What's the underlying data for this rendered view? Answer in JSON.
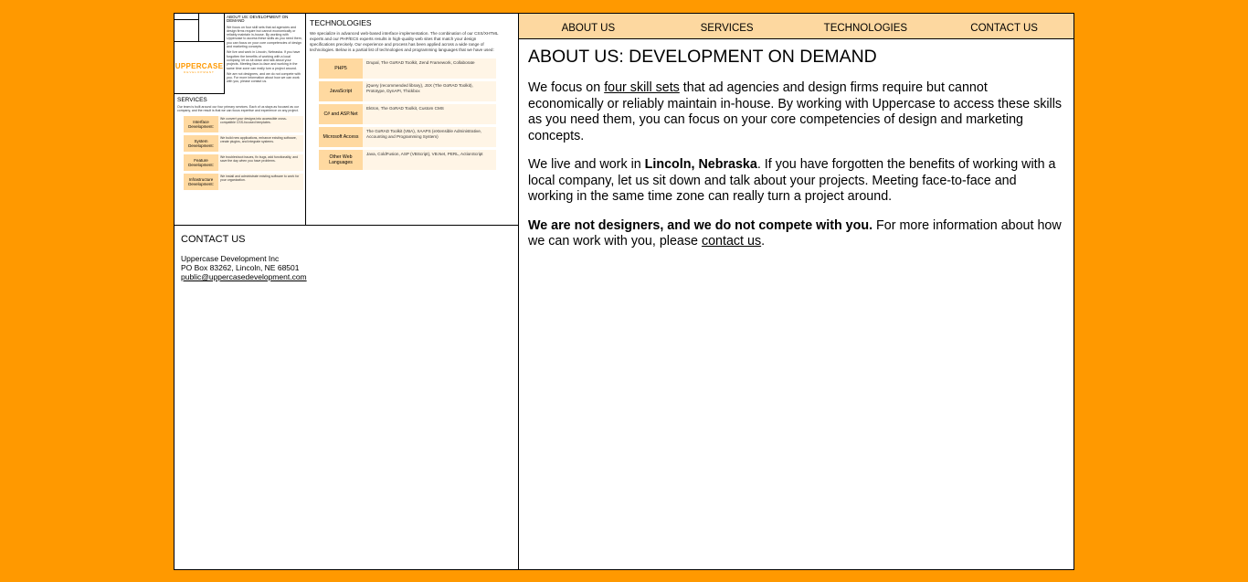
{
  "nav": {
    "about": "ABOUT US",
    "services": "SERVICES",
    "technologies": "TECHNOLOGIES",
    "contact": "CONTACT US"
  },
  "main": {
    "title": "ABOUT US: DEVELOPMENT ON DEMAND",
    "p1_a": "We focus on ",
    "p1_link": "four skill sets",
    "p1_b": " that ad agencies and design firms require but cannot economically or reliably maintain in-house. By working with Uppercase to access these skills as you need them, you can focus on your core competencies of design and marketing concepts.",
    "p2_a": "We live and work in ",
    "p2_bold": "Lincoln, Nebraska",
    "p2_b": ". If you have forgotten the benefits of working with a local company, let us sit down and talk about your projects. Meeting face-to-face and working in the same time zone can really turn a project around.",
    "p3_bold": "We are not designers, and we do not compete with you.",
    "p3_a": " For more information about how we can work with you, please ",
    "p3_link": "contact us",
    "p3_b": "."
  },
  "thumb": {
    "logo": "UPPERCASE",
    "logo_sub": "DEVELOPMENT",
    "about_title": "ABOUT US: DEVELOPMENT ON DEMAND",
    "about_p1": "We focus on four skill sets that ad agencies and design firms require but cannot economically or reliably maintain in-house. By working with Uppercase to access these skills as you need them, you can focus on your core competencies of design and marketing concepts.",
    "about_p2": "We live and work in Lincoln, Nebraska. If you have forgotten the benefits of working with a local company, let us sit down and talk about your projects. Meeting face-to-face and working in the same time zone can really turn a project around.",
    "about_p3": "We are not designers, and we do not compete with you. For more information about how we can work with you, please contact us."
  },
  "services": {
    "title": "SERVICES",
    "intro": "Our team is built around our four primary services. Each of us stays as focused as our company, and the result is that we can focus expertise and experience on any project.",
    "items": [
      {
        "name": "Interface Development:",
        "desc": "We convert your designs into accessible cross-compatible CSS-focused templates."
      },
      {
        "name": "System Development:",
        "desc": "We build new applications, enhance existing software, create plugins, and integrate systems."
      },
      {
        "name": "Feature Development:",
        "desc": "We troubleshoot issues, fix bugs, add functionality, and save the day when you have problems."
      },
      {
        "name": "Infrastructure Development:",
        "desc": "We install and administrate existing software to work for your organization."
      }
    ]
  },
  "technologies": {
    "title": "TECHNOLOGIES",
    "intro": "We specialize in advanced web-based interface implementation. The combination of our CSS/XHTML experts and our PHP/ECS experts results in high-quality web sites that match your design specifications precisely. Our experience and process has been applied across a wide range of technologies. Below is a partial list of technologies and programming languages that we have used:",
    "items": [
      {
        "name": "PHP5",
        "desc": "Drupal, The GoRAD Toolkit, Zend Framework, Collaborate"
      },
      {
        "name": "JavaScript",
        "desc": "jQuery (recommended library), JSX (The GoRAD Toolkit), Prototype, DynAPI, Thickbox"
      },
      {
        "name": "C# and ASP.Net",
        "desc": "Ektron, The GoRAD Toolkit, Custom CMS"
      },
      {
        "name": "Microsoft Access",
        "desc": "The GoRAD Toolkit (VBA), XAAPS (eXtensible Administrative, Accounting and Programming System)"
      },
      {
        "name": "Other Web Languages",
        "desc": "Java, ColdFusion, ASP (VBScript), VB.Net, PERL, ActionScript"
      }
    ]
  },
  "contact": {
    "title": "CONTACT US",
    "company": "Uppercase Development Inc",
    "address": "PO Box 83262, Lincoln, NE 68501",
    "email": "public@uppercasedevelopment.com"
  }
}
